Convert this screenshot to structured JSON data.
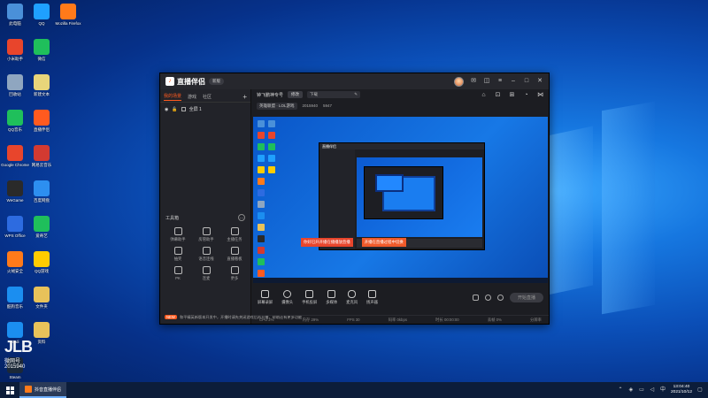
{
  "desktop": {
    "icons_col1": [
      {
        "label": "此电脑",
        "color": "#4a90d9"
      },
      {
        "label": "小米助手",
        "color": "#e8452c"
      },
      {
        "label": "回收站",
        "color": "#8fa6c0"
      },
      {
        "label": "QQ音乐",
        "color": "#1fbf5b"
      },
      {
        "label": "Google Chrome",
        "color": "#e8452c"
      },
      {
        "label": "WeGame",
        "color": "#2a2a2a"
      },
      {
        "label": "WPS Office",
        "color": "#2d6be0"
      },
      {
        "label": "火绒安全",
        "color": "#ff7a1a"
      },
      {
        "label": "酷狗音乐",
        "color": "#1b8ef0"
      },
      {
        "label": "Kodi",
        "color": "#1b8ef0"
      },
      {
        "label": "Steam",
        "color": "#1b2838"
      }
    ],
    "icons_col2": [
      {
        "label": "QQ",
        "color": "#1fa0ff"
      },
      {
        "label": "微信",
        "color": "#1fbf5b"
      },
      {
        "label": "新建文本",
        "color": "#e8d57a"
      },
      {
        "label": "直播伴侣",
        "color": "#ff5a1f"
      },
      {
        "label": "网易云音乐",
        "color": "#d33a31"
      },
      {
        "label": "百度网盘",
        "color": "#2d8ff0"
      },
      {
        "label": "爱奇艺",
        "color": "#1fbf5b"
      },
      {
        "label": "QQ游戏",
        "color": "#ffcc00"
      },
      {
        "label": "文件夹",
        "color": "#e8c25a"
      },
      {
        "label": "资料",
        "color": "#e8c25a"
      }
    ],
    "icons_col3": [
      {
        "label": "Mozilla Firefox",
        "color": "#ff7a1a"
      }
    ]
  },
  "watermark": {
    "big": "JLB",
    "sub": "微网号",
    "code": "2015940"
  },
  "app": {
    "name": "直播伴侣",
    "version_badge": "新版",
    "scene_tabs": [
      "我的场景",
      "游戏",
      "社区",
      "社交"
    ],
    "scene_row": "全屏 1",
    "toolbox_title": "工具箱",
    "tools": [
      "弹幕助手",
      "房管助手",
      "主播任务",
      "抽奖",
      "语音连线",
      "直播看板",
      "PK",
      "连麦",
      "更多"
    ],
    "notice": "和平精英新版本开发中，开播时请先关闭游戏后再开播，帮助还有更多功能",
    "notice_tag": "NEW",
    "room_title": "钟飞鹏神专号",
    "edit_btn": "修改",
    "room_input": "下载",
    "category": "英雄联盟 · LOL游戏",
    "room_id": "2015940",
    "fans": "5947",
    "banner_left": "你好已开开播在播播放直播",
    "banner_right": "开播在直播过程中切换",
    "controls": [
      "屏幕录屏",
      "摄像头",
      "手机投屏",
      "多媒体",
      "麦克风",
      "扬声器"
    ],
    "start_label": "开始直播",
    "status": [
      "CPU 2%",
      "内存 29%",
      "FPS 30",
      "码率 0kbps",
      "时长 00:00:00",
      "丢帧 0%",
      "分辨率"
    ]
  },
  "taskbar": {
    "app_label": "抖音直播伴侣",
    "time": "13:04:40",
    "date": "2021/10/12"
  }
}
